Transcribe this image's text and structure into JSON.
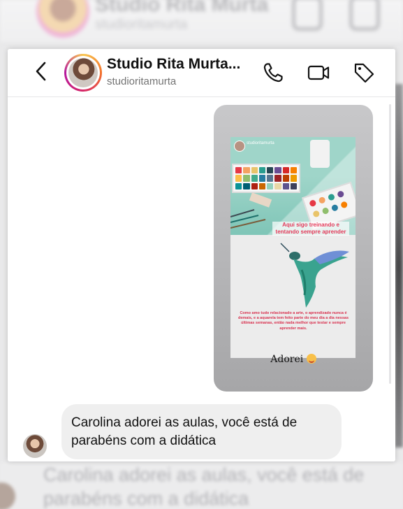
{
  "header": {
    "title": "Studio Rita Murta...",
    "username": "studioritamurta"
  },
  "story": {
    "username": "studioritamurta",
    "caption_top": "Aqui sigo treinando e tentando sempre aprender",
    "caption_bottom": "Como amo tudo relacionado a arte, o aprendizado nunca é demais, e a aquarela tem feito parte do meu dia a dia nessas últimas semanas, então nada melhor que testar e sempre aprender mais.",
    "reply_text": "Adorei"
  },
  "message": {
    "text": "Carolina adorei as aulas, você está de parabéns com a didática"
  },
  "background": {
    "blurred_name": "Studio Rita Murta",
    "blurred_user": "studioritamurta",
    "blurred_message": "Carolina adorei as aulas, você está de parabéns com a didática"
  },
  "icons": {
    "back": "chevron-left-icon",
    "call": "phone-icon",
    "video": "video-camera-icon",
    "tag": "tag-icon"
  },
  "colors": {
    "bubble_gray": "#efefef",
    "caption_red": "#e43a5a",
    "ring_gradient": [
      "#f9c74f",
      "#f3722c",
      "#d62868",
      "#b5179e"
    ]
  }
}
